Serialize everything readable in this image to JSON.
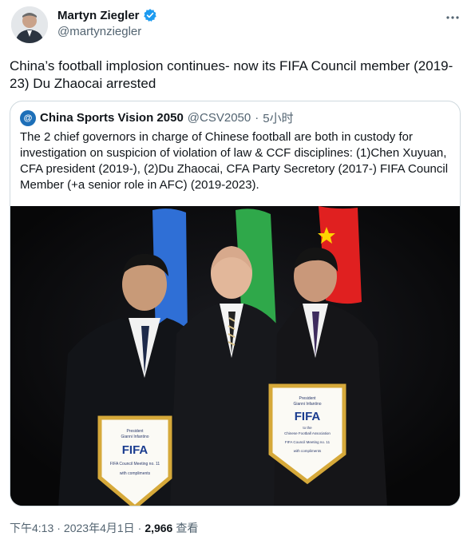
{
  "author": {
    "name": "Martyn Ziegler",
    "handle": "@martynziegler",
    "verified_color": "#1d9bf0"
  },
  "tweet": {
    "text": "China’s football implosion continues- now its FIFA Council member (2019-23) Du Zhaocai arrested"
  },
  "quote": {
    "name": "China Sports Vision 2050",
    "handle": "@CSV2050",
    "separator": "·",
    "time": "5小时",
    "text": "The 2 chief governors in charge of Chinese football are both in custody for investigation on suspicion of violation of law & CCF disciplines: (1)Chen Xuyuan, CFA president (2019-), (2)Du Zhaocai, CFA Party Secretory (2017-) FIFA Council Member (+a senior role in AFC) (2019-2023).",
    "photo": {
      "pennant_left": {
        "line1": "President",
        "line2": "Gianni Infantino",
        "logo": "FIFA",
        "line3": "FIFA Council Meeting no. 11",
        "line4": "with compliments"
      },
      "pennant_right": {
        "line1": "President",
        "line2": "Gianni Infantino",
        "logo": "FIFA",
        "line3": "to the",
        "line4": "Chinese Football Association",
        "line5": "FIFA Council Meeting no. 11",
        "line6": "with compliments"
      }
    }
  },
  "footer": {
    "time": "下午4:13",
    "dot1": "·",
    "date": "2023年4月1日",
    "dot2": "·",
    "views": "2,966",
    "views_label": "查看"
  },
  "icons": {
    "verified": "verified-badge-icon",
    "more": "more-icon"
  }
}
